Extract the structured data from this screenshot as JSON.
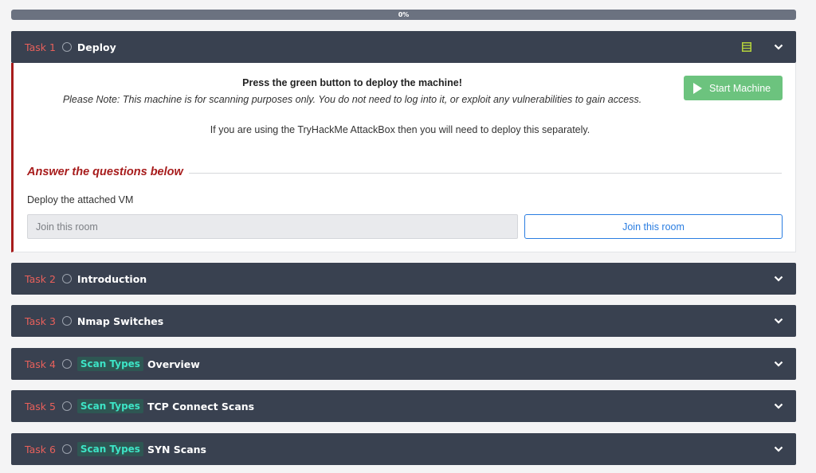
{
  "progress": {
    "label": "0%",
    "value": 0
  },
  "tasks": [
    {
      "num": "Task 1",
      "title": "Deploy",
      "tag": "",
      "expanded": true
    },
    {
      "num": "Task 2",
      "title": "Introduction",
      "tag": ""
    },
    {
      "num": "Task 3",
      "title": "Nmap Switches",
      "tag": ""
    },
    {
      "num": "Task 4",
      "title": "Overview",
      "tag": "Scan Types"
    },
    {
      "num": "Task 5",
      "title": "TCP Connect Scans",
      "tag": "Scan Types"
    },
    {
      "num": "Task 6",
      "title": "SYN Scans",
      "tag": "Scan Types"
    }
  ],
  "task1": {
    "deploy_title": "Press the green button to deploy the machine!",
    "deploy_note": "Please Note: This machine is for scanning purposes only. You do not need to log into it, or exploit any vulnerabilities to gain access.",
    "attackbox_text": "If you are using the TryHackMe AttackBox then you will need to deploy this separately.",
    "start_button": "Start Machine",
    "answer_heading": "Answer the questions below",
    "question": "Deploy the attached VM",
    "answer_placeholder": "Join this room",
    "join_button": "Join this room"
  },
  "icons": {
    "notes": "notes-icon",
    "chevron": "chevron-down-icon",
    "status": "circle-icon",
    "play": "play-icon"
  },
  "colors": {
    "header_bg": "#394150",
    "task_num": "#e8605b",
    "accent_red": "#a71c1c",
    "green_button": "#6cc37e",
    "tag_text": "#3de4c6",
    "link_blue": "#2a7de1"
  }
}
